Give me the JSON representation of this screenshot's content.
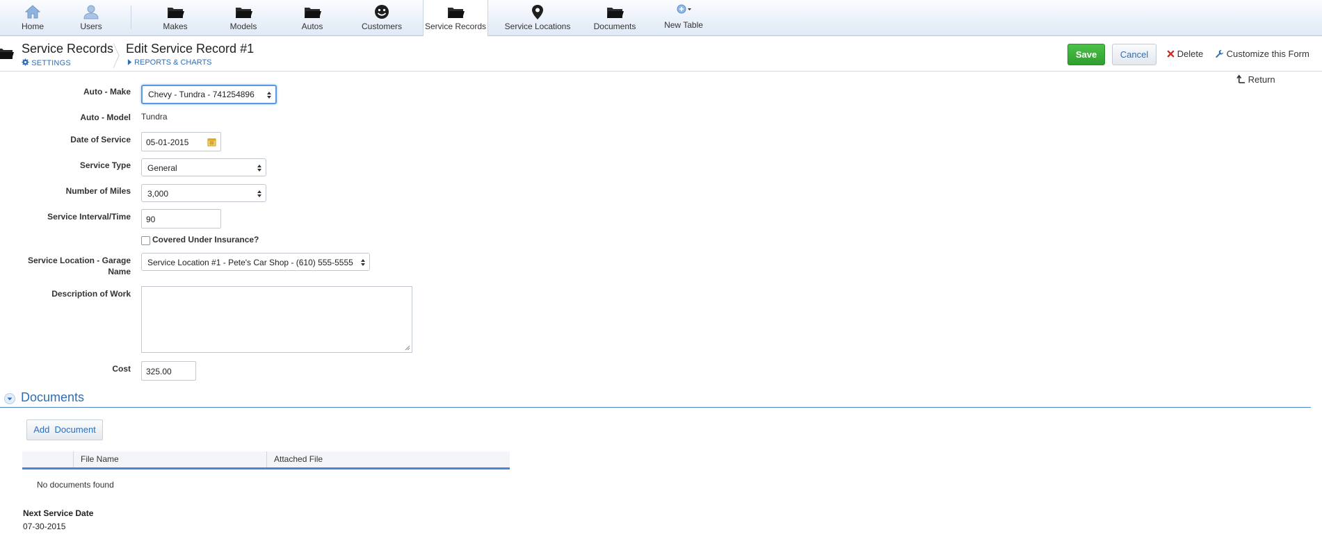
{
  "nav": {
    "items": [
      {
        "label": "Home",
        "icon": "home-icon"
      },
      {
        "label": "Users",
        "icon": "user-icon"
      },
      {
        "label": "Makes",
        "icon": "folder-icon"
      },
      {
        "label": "Models",
        "icon": "folder-icon"
      },
      {
        "label": "Autos",
        "icon": "folder-icon"
      },
      {
        "label": "Customers",
        "icon": "smiley-icon"
      },
      {
        "label": "Service Records",
        "icon": "folder-open-icon",
        "active": true
      },
      {
        "label": "Service Locations",
        "icon": "map-pin-icon"
      },
      {
        "label": "Documents",
        "icon": "folder-icon"
      },
      {
        "label": "New Table",
        "icon": "add-table-icon"
      }
    ]
  },
  "header": {
    "app_title": "Service Records",
    "settings_label": "SETTINGS",
    "page_title": "Edit Service Record #1",
    "reports_label": "REPORTS & CHARTS"
  },
  "actions": {
    "save": "Save",
    "cancel": "Cancel",
    "delete": "Delete",
    "customize": "Customize this Form",
    "return": "Return"
  },
  "form": {
    "auto_make": {
      "label": "Auto - Make",
      "value": "Chevy - Tundra - 741254896"
    },
    "auto_model": {
      "label": "Auto - Model",
      "value": "Tundra"
    },
    "date_of_service": {
      "label": "Date of Service",
      "value": "05-01-2015"
    },
    "service_type": {
      "label": "Service Type",
      "value": "General"
    },
    "number_of_miles": {
      "label": "Number of Miles",
      "value": "3,000"
    },
    "service_interval": {
      "label": "Service Interval/Time",
      "value": "90"
    },
    "covered_insurance": {
      "label": "Covered Under Insurance?",
      "checked": false
    },
    "service_location": {
      "label_line1": "Service Location - Garage",
      "label_line2": "Name",
      "value": "Service Location #1 - Pete's Car Shop - (610) 555-5555"
    },
    "description": {
      "label": "Description of Work",
      "value": ""
    },
    "cost": {
      "label": "Cost",
      "value": "325.00"
    }
  },
  "documents": {
    "title": "Documents",
    "add_button": "Add  Document",
    "columns": [
      "File Name",
      "Attached File"
    ],
    "empty_text": "No documents found"
  },
  "next_service": {
    "label": "Next Service Date",
    "value": "07-30-2015"
  },
  "colors": {
    "accent_blue": "#2f6db5",
    "save_green": "#3bb139",
    "delete_red": "#d9261c"
  }
}
